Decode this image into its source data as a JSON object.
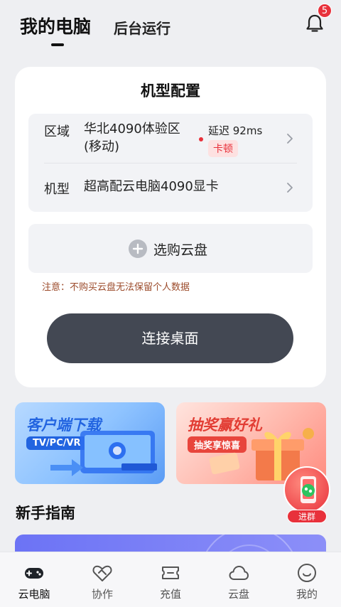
{
  "header": {
    "tabs": [
      {
        "label": "我的电脑",
        "active": true
      },
      {
        "label": "后台运行",
        "active": false
      }
    ],
    "notification_count": "5",
    "notification_icon": "bell-icon"
  },
  "config": {
    "title": "机型配置",
    "region": {
      "label": "区域",
      "value_line1": "华北4090体验区",
      "value_line2": "(移动)",
      "latency": "延迟 92ms",
      "status_tag": "卡顿"
    },
    "model": {
      "label": "机型",
      "value": "超高配云电脑4090显卡"
    },
    "buy_disk_label": "选购云盘",
    "notice": "注意：不购买云盘无法保留个人数据",
    "connect_label": "连接桌面"
  },
  "banners": [
    {
      "title": "客户端下载",
      "tag": "TV/PC/VR"
    },
    {
      "title": "抽奖赢好礼",
      "tag": "抽奖享惊喜"
    }
  ],
  "float_button": {
    "label": "进群"
  },
  "guide": {
    "title": "新手指南"
  },
  "nav": [
    {
      "label": "云电脑",
      "icon": "gamepad-icon",
      "active": true
    },
    {
      "label": "协作",
      "icon": "handshake-icon",
      "active": false
    },
    {
      "label": "充值",
      "icon": "ticket-icon",
      "active": false
    },
    {
      "label": "云盘",
      "icon": "cloud-icon",
      "active": false
    },
    {
      "label": "我的",
      "icon": "smile-icon",
      "active": false
    }
  ],
  "colors": {
    "accent_red": "#e8313b",
    "button_dark": "#434853",
    "background": "#eeeff2"
  }
}
